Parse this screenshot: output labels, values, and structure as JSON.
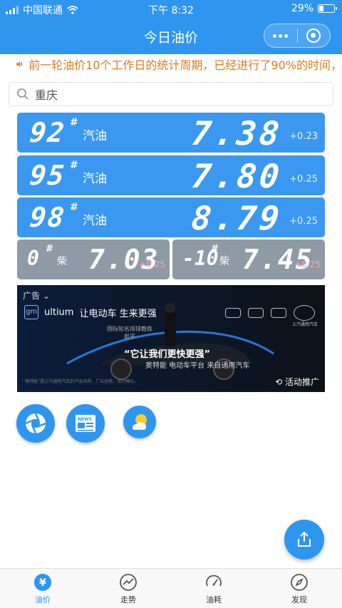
{
  "status_bar": {
    "carrier": "中国联通",
    "time": "下午 8:32",
    "battery": "29%"
  },
  "header": {
    "title": "今日油价"
  },
  "notice": {
    "text": "前一轮油价10个工作日的统计周期，已经进行了90%的时间，"
  },
  "search": {
    "value": "重庆"
  },
  "fuels": [
    {
      "grade": "92",
      "hash": "#",
      "type": "汽油",
      "price": "7.38",
      "change": "+0.23"
    },
    {
      "grade": "95",
      "hash": "#",
      "type": "汽油",
      "price": "7.80",
      "change": "+0.25"
    },
    {
      "grade": "98",
      "hash": "#",
      "type": "汽油",
      "price": "8.79",
      "change": "+0.25"
    }
  ],
  "diesel": [
    {
      "grade": "0",
      "hash": "#",
      "type": "柴",
      "price": "7.03",
      "change": "+0.25"
    },
    {
      "grade": "-10",
      "hash": "#",
      "type": "柴",
      "price": "7.45",
      "change": "+0.25"
    }
  ],
  "ad": {
    "label": "广告",
    "brand": "ultium",
    "tagline": "让电动车 生来更强",
    "coach": "国际知名排球教练",
    "coach_name": "郎平",
    "slogan": "“它让我们更快更强”",
    "sub": "奥特能 电动车平台 来自通用汽车",
    "promo": "活动推广",
    "fine_print": "“奥特能”是上汽通用汽车的产品名称。广告创意，请勿模仿。",
    "saic": "上汽通用汽车"
  },
  "tabs": [
    {
      "label": "油价",
      "active": true
    },
    {
      "label": "走势",
      "active": false
    },
    {
      "label": "油耗",
      "active": false
    },
    {
      "label": "发现",
      "active": false
    }
  ],
  "colors": {
    "primary": "#2f96ef",
    "notice": "#e07a1e",
    "diesel_card": "#8e9aa6"
  }
}
